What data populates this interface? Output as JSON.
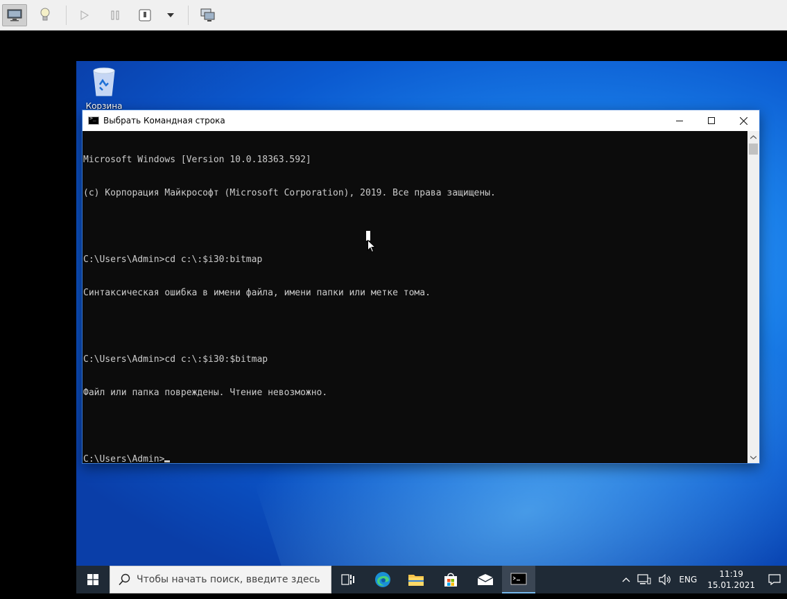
{
  "desktop": {
    "recycle_bin_label": "Корзина"
  },
  "cmd": {
    "title": "Выбрать Командная строка",
    "lines": [
      "Microsoft Windows [Version 10.0.18363.592]",
      "(c) Корпорация Майкрософт (Microsoft Corporation), 2019. Все права защищены.",
      "",
      "C:\\Users\\Admin>cd c:\\:$i30:bitmap",
      "Синтаксическая ошибка в имени файла, имени папки или метке тома.",
      "",
      "C:\\Users\\Admin>cd c:\\:$i30:$bitmap",
      "Файл или папка повреждены. Чтение невозможно.",
      ""
    ],
    "prompt": "C:\\Users\\Admin>",
    "controls": {
      "minimize": "—",
      "maximize": "☐",
      "close": "✕"
    }
  },
  "taskbar": {
    "search_placeholder": "Чтобы начать поиск, введите здесь",
    "tray": {
      "language": "ENG",
      "time": "11:19",
      "date": "15.01.2021"
    }
  },
  "colors": {
    "taskbar_bg": "#1f2a36",
    "console_bg": "#0c0c0c",
    "console_fg": "#cccccc",
    "accent": "#0b5ad0"
  }
}
